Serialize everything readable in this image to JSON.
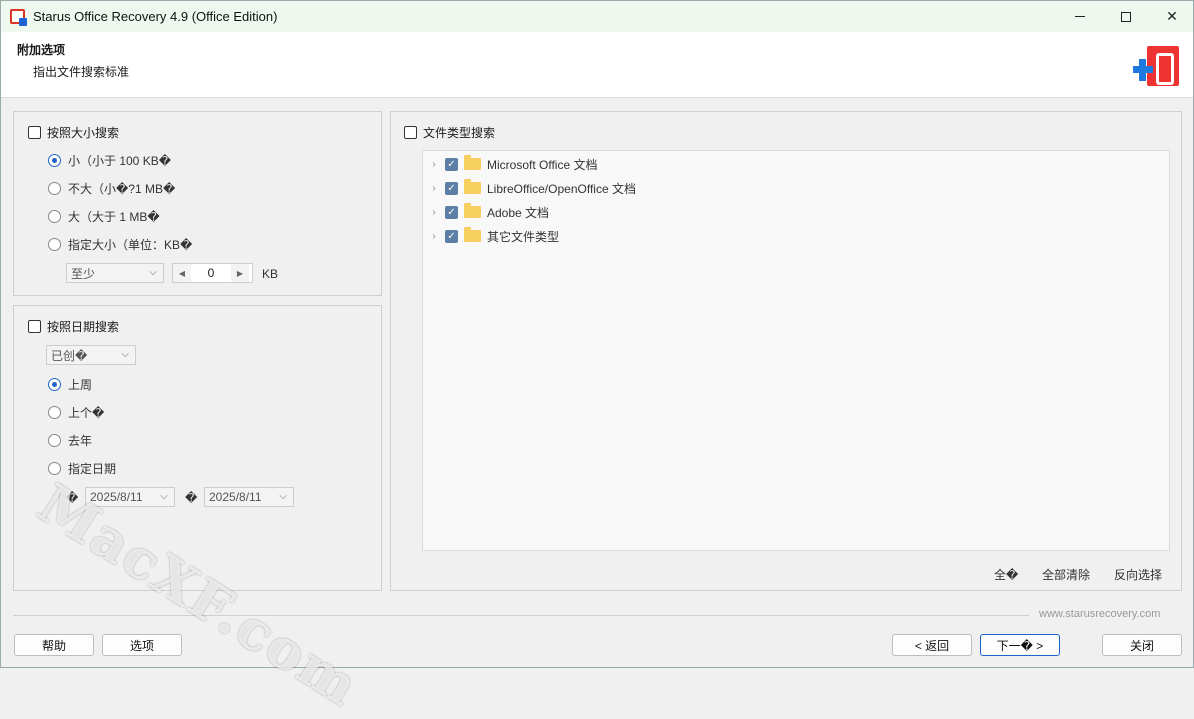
{
  "window": {
    "title": "Starus Office Recovery 4.9 (Office Edition)"
  },
  "header": {
    "title": "附加选项",
    "subtitle": "指出文件搜索标准"
  },
  "size_search": {
    "checkbox_label": "按照大小搜索",
    "options": [
      "小（小于 100 KB�",
      "不大（小�?1 MB�",
      "大（大于 1 MB�",
      "指定大小（单位：KB�"
    ],
    "selected_index": 0,
    "compare_value": "至少",
    "size_value": "0",
    "unit": "KB"
  },
  "date_search": {
    "checkbox_label": "按照日期搜索",
    "mode_value": "已创�",
    "options": [
      "上周",
      "上个�",
      "去年",
      "指定日期"
    ],
    "selected_index": 0,
    "from_label": "�",
    "from_date": "2025/8/11",
    "to_label": "�",
    "to_date": "2025/8/11"
  },
  "type_search": {
    "checkbox_label": "文件类型搜索",
    "items": [
      {
        "label": "Microsoft Office 文档",
        "checked": true
      },
      {
        "label": "LibreOffice/OpenOffice 文档",
        "checked": true
      },
      {
        "label": "Adobe 文档",
        "checked": true
      },
      {
        "label": "其它文件类型",
        "checked": true
      }
    ],
    "select_all": "全�",
    "clear_all": "全部清除",
    "invert": "反向选择"
  },
  "footer": {
    "website": "www.starusrecovery.com",
    "help": "帮助",
    "options": "选项",
    "back": "< 返回",
    "next": "下一� >",
    "close": "关闭"
  },
  "watermark": "MacXF.com",
  "colors": {
    "accent": "#1f64c8",
    "titlebar": "#eef8ee",
    "folder": "#f6cf5e"
  }
}
